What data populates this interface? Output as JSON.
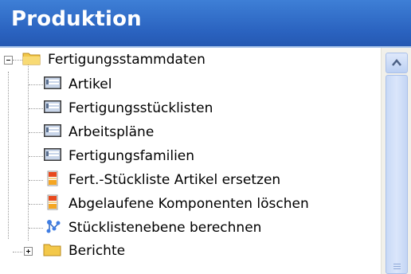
{
  "header": {
    "title": "Produktion"
  },
  "tree": {
    "root": {
      "label": "Fertigungsstammdaten",
      "icon": "folder-open-icon",
      "expanded": true
    },
    "items": [
      {
        "label": "Artikel",
        "icon": "list-form-icon"
      },
      {
        "label": "Fertigungsstücklisten",
        "icon": "list-form-icon"
      },
      {
        "label": "Arbeitspläne",
        "icon": "list-form-icon"
      },
      {
        "label": "Fertigungsfamilien",
        "icon": "list-form-icon"
      },
      {
        "label": "Fert.-Stückliste Artikel ersetzen",
        "icon": "batch-job-icon"
      },
      {
        "label": "Abgelaufene Komponenten löschen",
        "icon": "batch-job-icon"
      },
      {
        "label": "Stücklistenebene berechnen",
        "icon": "structure-icon"
      }
    ],
    "second_root": {
      "label": "Berichte",
      "icon": "folder-closed-icon",
      "expanded": false
    }
  },
  "colors": {
    "header_bg": "#2a62bf",
    "folder": "#f3c84a",
    "batch_icon": "#e8491d"
  }
}
